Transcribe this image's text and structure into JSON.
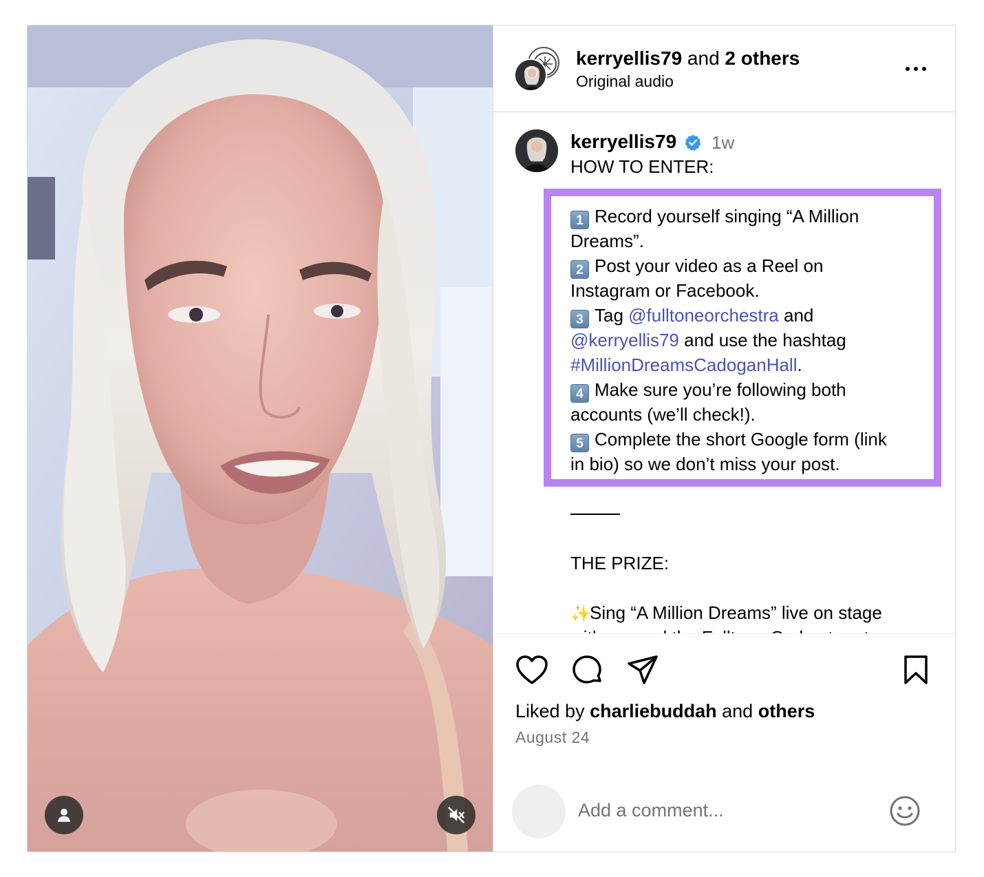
{
  "header": {
    "username": "kerryellis79",
    "joiner": "and",
    "others": "2 others",
    "subtitle": "Original audio",
    "more_icon": "more-horizontal-icon"
  },
  "caption": {
    "username": "kerryellis79",
    "verified_icon": "verified-badge-icon",
    "time": "1w",
    "heading": "HOW TO ENTER:",
    "steps": [
      {
        "num": "1",
        "line1": "Record yourself singing “A Million",
        "line2": "Dreams”."
      },
      {
        "num": "2",
        "line1": "Post your video as a Reel on",
        "line2": "Instagram or Facebook."
      },
      {
        "num": "3",
        "line1_pre": "Tag ",
        "line1_link": "@fulltoneorchestra",
        "line1_post": " and",
        "line2_link": "@kerryellis79",
        "line2_post": " and use the hashtag",
        "line3_link": "#MillionDreamsCadoganHall",
        "line3_post": "."
      },
      {
        "num": "4",
        "line1": "Make sure you’re following both",
        "line2": "accounts (we’ll check!)."
      },
      {
        "num": "5",
        "line1": "Complete the short Google form (link",
        "line2": "in bio) so we don’t miss your post."
      }
    ],
    "prize_heading": "THE PRIZE:",
    "prize_line1": "Sing “A Million Dreams” live on stage",
    "prize_line2_partial": "with me and the Fulltone Orchestra at"
  },
  "actions": {
    "like_icon": "heart-icon",
    "comment_icon": "comment-icon",
    "share_icon": "send-icon",
    "save_icon": "bookmark-icon"
  },
  "likes": {
    "prefix": "Liked by",
    "user": "charliebuddah",
    "joiner": "and",
    "others": "others"
  },
  "date": "August 24",
  "comment": {
    "placeholder": "Add a comment...",
    "emoji_icon": "emoji-icon"
  },
  "media": {
    "user_icon": "user-tag-icon",
    "mute_icon": "muted-speaker-icon"
  },
  "colors": {
    "link": "#4a52b8",
    "highlight": "#b784f2",
    "verified": "#3897f0",
    "muted_text": "#737373"
  }
}
